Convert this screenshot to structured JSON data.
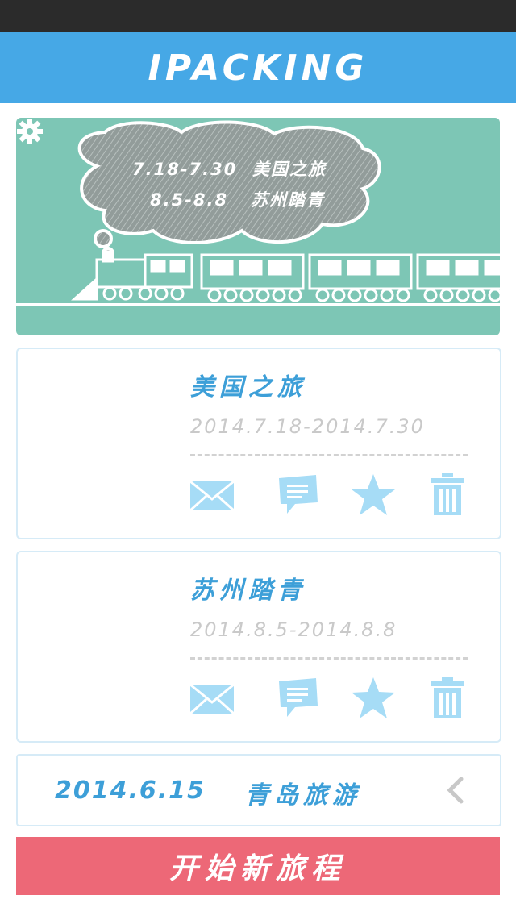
{
  "app": {
    "title": "IPACKING"
  },
  "banner": {
    "lines": [
      "7.18-7.30  美国之旅",
      "8.5-8.8   苏州踏青"
    ],
    "settings_icon": "gear-icon",
    "colors": {
      "background": "#7dc6b5",
      "cloud": "#8e9a98",
      "train": "#ffffff"
    }
  },
  "trips": [
    {
      "name": "美国之旅",
      "dates": "2014.7.18-2014.7.30",
      "actions": [
        "mail-icon",
        "chat-icon",
        "star-icon",
        "trash-icon"
      ]
    },
    {
      "name": "苏州踏青",
      "dates": "2014.8.5-2014.8.8",
      "actions": [
        "mail-icon",
        "chat-icon",
        "star-icon",
        "trash-icon"
      ]
    }
  ],
  "past_trip": {
    "date": "2014.6.15",
    "name": "青岛旅游",
    "expand_icon": "chevron-left-icon"
  },
  "start_button": {
    "label": "开始新旅程"
  },
  "colors": {
    "header": "#46a8e6",
    "accent_text": "#3d9fd8",
    "icon": "#a6dcf6",
    "button": "#ed6877",
    "status_bar": "#2b2b2b"
  }
}
